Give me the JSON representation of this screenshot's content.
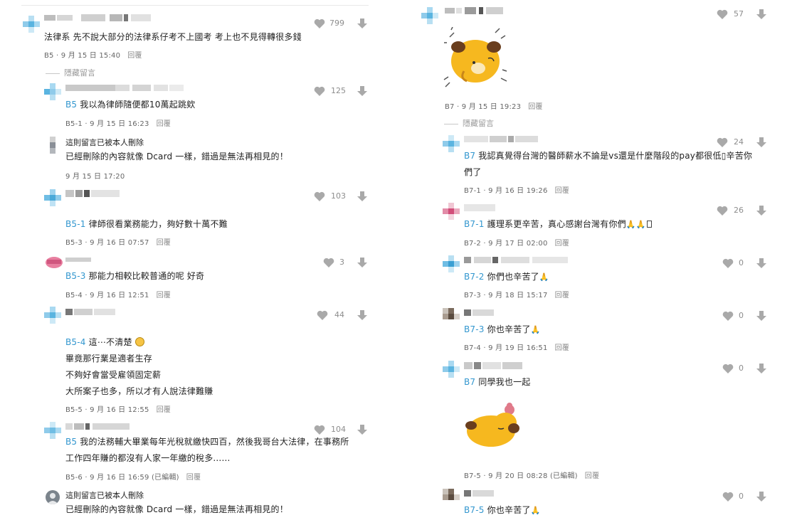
{
  "left": {
    "c1": {
      "text": "法律系 先不說大部分的法律系仔考不上國考 考上也不見得轉很多錢",
      "likes": "799",
      "floor": "B5",
      "date": "9 月 15 日 15:40",
      "reply": "回覆"
    },
    "hidden_label": "隱藏留言",
    "c2": {
      "ref": "B5",
      "text": "我以為律師隨便都10萬起跳欸",
      "likes": "125",
      "floor": "B5-1",
      "date": "9 月 15 日 16:23",
      "reply": "回覆"
    },
    "c3": {
      "title": "這則留言已被本人刪除",
      "text": "已經刪除的內容就像 Dcard 一樣，錯過是無法再相見的！",
      "date": "9 月 15 日 17:20"
    },
    "c4": {
      "ref": "B5-1",
      "text": "律師很看業務能力，夠好數十萬不難",
      "likes": "103",
      "floor": "B5-3",
      "date": "9 月 16 日 07:57",
      "reply": "回覆"
    },
    "c5": {
      "ref": "B5-3",
      "text": "那能力相較比較普通的呢 好奇",
      "likes": "3",
      "floor": "B5-4",
      "date": "9 月 16 日 12:51",
      "reply": "回覆"
    },
    "c6": {
      "ref": "B5-4",
      "line1": "這⋯不清楚",
      "line2": "畢竟那行業是適者生存",
      "line3": "不夠好會當受雇領固定薪",
      "line4": "大所案子也多，所以才有人說法律難賺",
      "likes": "44",
      "floor": "B5-5",
      "date": "9 月 16 日 12:55",
      "reply": "回覆"
    },
    "c7": {
      "ref": "B5",
      "line1": "我的法務輔大畢業每年光稅就繳快四百，然後我哥台大法律，在事務所",
      "line2": "工作四年賺的都沒有人家一年繳的稅多......",
      "likes": "104",
      "floor": "B5-6",
      "date": "9 月 16 日 16:59 (已編輯)",
      "reply": "回覆"
    },
    "c8": {
      "title": "這則留言已被本人刪除",
      "text": "已經刪除的內容就像 Dcard 一樣，錯過是無法再相見的！"
    }
  },
  "right": {
    "r1": {
      "likes": "57",
      "floor": "B7",
      "date": "9 月 15 日 19:23",
      "reply": "回覆"
    },
    "hidden_label": "隱藏留言",
    "r2": {
      "ref": "B7",
      "line1": "我認真覺得台灣的醫師薪水不論是vs還是什麼階段的pay都很低▯辛苦你",
      "line2": "們了",
      "likes": "24",
      "floor": "B7-1",
      "date": "9 月 16 日 19:26",
      "reply": "回覆"
    },
    "r3": {
      "ref": "B7-1",
      "text": "護理系更辛苦，真心感謝台灣有你們",
      "likes": "26",
      "floor": "B7-2",
      "date": "9 月 17 日 02:00",
      "reply": "回覆"
    },
    "r4": {
      "ref": "B7-2",
      "text": "你們也辛苦了",
      "likes": "0",
      "floor": "B7-3",
      "date": "9 月 18 日 15:17",
      "reply": "回覆"
    },
    "r5": {
      "ref": "B7-3",
      "text": "你也辛苦了",
      "likes": "0",
      "floor": "B7-4",
      "date": "9 月 19 日 16:51",
      "reply": "回覆"
    },
    "r6": {
      "ref": "B7",
      "text": "同學我也一起",
      "likes": "0",
      "floor": "B7-5",
      "date": "9 月 20 日 08:28 (已編輯)",
      "reply": "回覆"
    },
    "r7": {
      "ref": "B7-5",
      "text": "你也辛苦了",
      "likes": "0"
    }
  },
  "colors": {
    "accent": "#3397cf",
    "icon": "#a9a9a9",
    "text": "#222222",
    "meta": "#666666"
  },
  "icons": [
    "heart-icon",
    "thumbs-down-icon",
    "avatar-icon",
    "pray-emoji-icon",
    "sticker-dog-icon"
  ]
}
